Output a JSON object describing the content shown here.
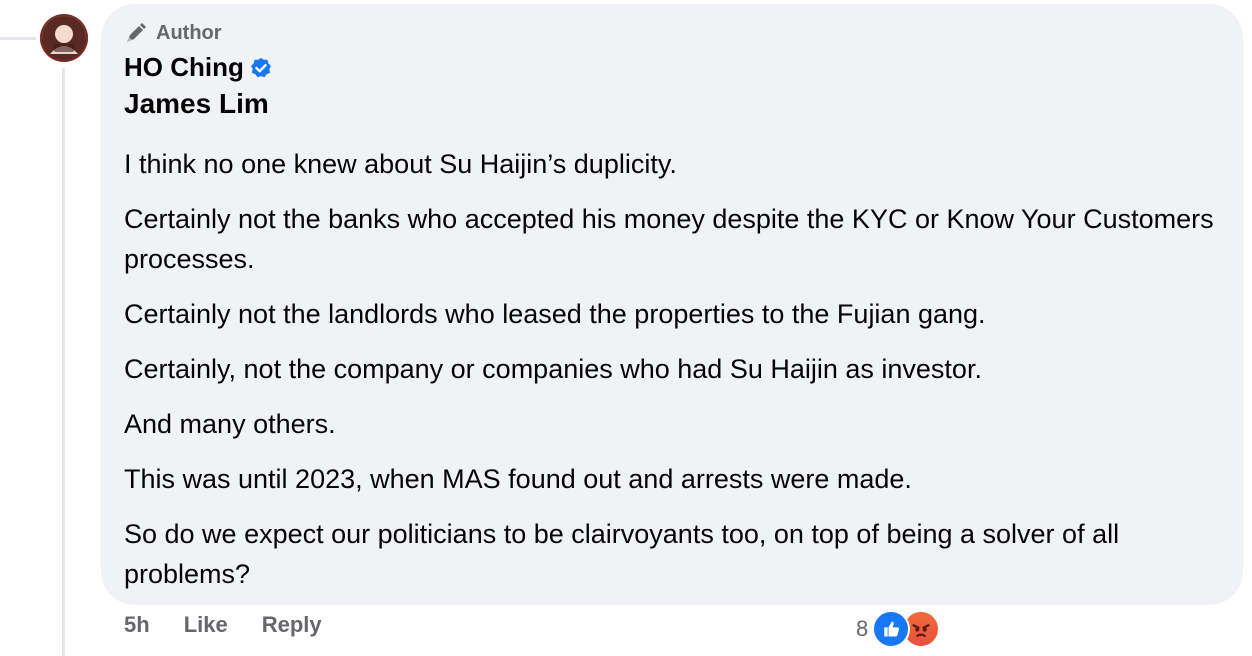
{
  "comment": {
    "author_badge": "Author",
    "author_name": "HO Ching",
    "mention": "James Lim",
    "paragraphs": [
      "I think no one knew about Su Haijin’s duplicity.",
      "Certainly not the banks who accepted his money despite the KYC or Know Your Customers processes.",
      "Certainly not the landlords who leased the properties to the Fujian gang.",
      "Certainly, not the company or companies who had Su Haijin as investor.",
      "And many others.",
      "This was until 2023, when MAS found out and arrests were made.",
      "So do we expect our politicians to be clairvoyants too, on top of being a solver of all problems?"
    ],
    "time": "5h",
    "like_label": "Like",
    "reply_label": "Reply",
    "reaction_count": "8",
    "reactions": [
      "like-icon",
      "angry-icon"
    ]
  },
  "colors": {
    "bubble": "#f0f2f5",
    "meta_text": "#65676b",
    "verified": "#1877f2",
    "like": "#1877f2",
    "angry": "#e9503c"
  }
}
